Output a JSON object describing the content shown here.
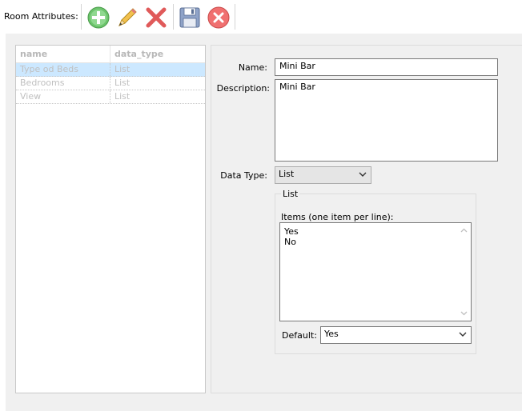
{
  "toolbar": {
    "title": "Room Attributes:",
    "buttons": [
      {
        "icon": "add-icon",
        "color": "#5cb85c"
      },
      {
        "icon": "pencil-icon",
        "color": "#f2c14e"
      },
      {
        "icon": "delete-icon",
        "color": "#e05a5a"
      },
      {
        "icon": "save-icon",
        "color": "#6a7fa8"
      },
      {
        "icon": "cancel-icon",
        "color": "#f07070"
      }
    ]
  },
  "grid": {
    "columns": [
      "name",
      "data_type"
    ],
    "rows": [
      {
        "name": "Type od Beds",
        "data_type": "List",
        "selected": true
      },
      {
        "name": "Bedrooms",
        "data_type": "List",
        "selected": false
      },
      {
        "name": "View",
        "data_type": "List",
        "selected": false
      }
    ]
  },
  "form": {
    "name_label": "Name:",
    "name_value": "Mini Bar",
    "description_label": "Description:",
    "description_value": "Mini Bar",
    "data_type_label": "Data Type:",
    "data_type_value": "List",
    "list_group_label": "List",
    "items_label": "Items (one item per line):",
    "items": [
      "Yes",
      "No"
    ],
    "default_label": "Default:",
    "default_value": "Yes"
  },
  "colors": {
    "selection": "#cce8ff",
    "panel_bg": "#f0f0f0"
  }
}
